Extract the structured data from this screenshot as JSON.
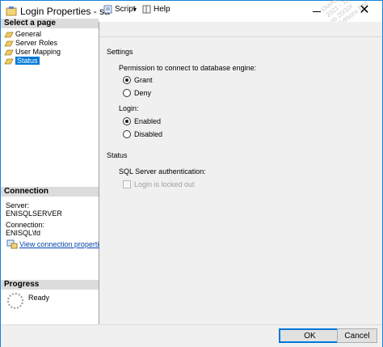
{
  "window": {
    "title": "Login Properties - sa",
    "close_glyph": "✕"
  },
  "left_panel": {
    "select_page_header": "Select a page",
    "pages": [
      {
        "label": "General"
      },
      {
        "label": "Server Roles"
      },
      {
        "label": "User Mapping"
      },
      {
        "label": "Status",
        "selected": true
      }
    ],
    "connection_header": "Connection",
    "server_label": "Server:",
    "server_value": "ENISQLSERVER",
    "connection_label": "Connection:",
    "connection_value": "ENISQL\\fd",
    "view_link": "View connection properties",
    "progress_header": "Progress",
    "progress_status": "Ready"
  },
  "toolbar": {
    "script_label": "Script",
    "help_label": "Help"
  },
  "settings": {
    "section_title": "Settings",
    "permission_label": "Permission to connect to database engine:",
    "grant_label": "Grant",
    "deny_label": "Deny",
    "permission_selected": "Grant",
    "login_label": "Login:",
    "enabled_label": "Enabled",
    "disabled_label": "Disabled",
    "login_selected": "Enabled",
    "status_title": "Status",
    "sql_auth_label": "SQL Server authentication:",
    "locked_out_label": "Login is locked out",
    "locked_out_checked": false
  },
  "buttons": {
    "ok_label": "OK",
    "cancel_label": "Cancel"
  },
  "watermark": {
    "lines": [
      "Ouvrage pré-",
      "2021 - 10 Ve",
      "ss 20/10/",
      "©Editions ENI"
    ]
  }
}
